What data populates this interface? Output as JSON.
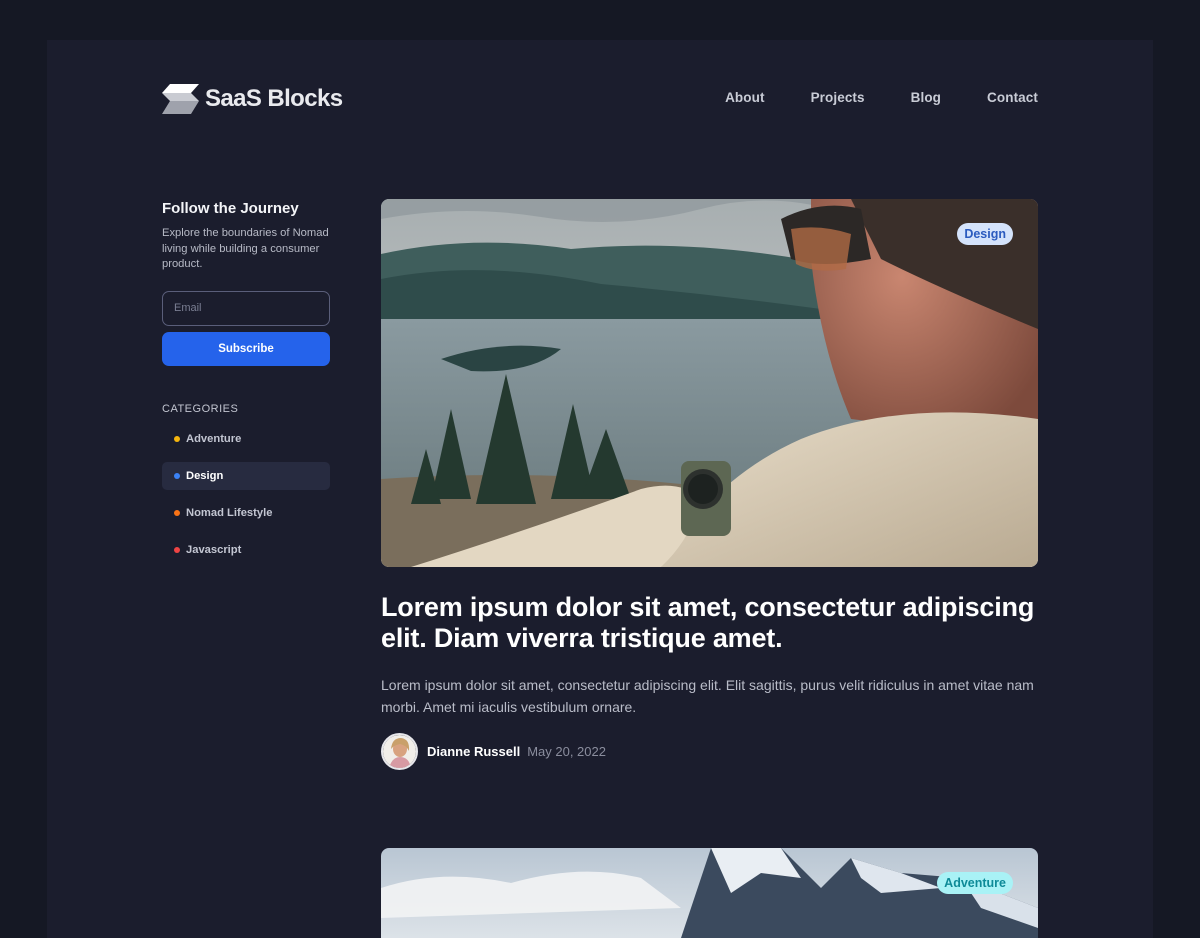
{
  "header": {
    "logo_text": "SaaS Blocks",
    "nav": [
      "About",
      "Projects",
      "Blog",
      "Contact"
    ]
  },
  "sidebar": {
    "title": "Follow the Journey",
    "description": "Explore the boundaries of Nomad living while building a consumer product.",
    "email_placeholder": "Email",
    "email_value": "",
    "subscribe_label": "Subscribe",
    "categories_heading": "CATEGORIES",
    "categories": [
      {
        "label": "Adventure",
        "dot_color": "#f5b50e",
        "active": false
      },
      {
        "label": "Design",
        "dot_color": "#3b82f6",
        "active": true
      },
      {
        "label": "Nomad Lifestyle",
        "dot_color": "#f97316",
        "active": false
      },
      {
        "label": "Javascript",
        "dot_color": "#ef4444",
        "active": false
      }
    ]
  },
  "posts": [
    {
      "badge": "Design",
      "title": "Lorem ipsum dolor sit amet, consectetur adipiscing elit. Diam viverra tristique amet.",
      "excerpt": "Lorem ipsum dolor sit amet, consectetur adipiscing elit. Elit sagittis, purus velit ridiculus in amet vitae nam morbi. Amet mi iaculis vestibulum ornare.",
      "author": "Dianne Russell",
      "date": "May 20, 2022"
    },
    {
      "badge": "Adventure"
    }
  ],
  "colors": {
    "page_bg": "#151824",
    "frame_bg": "#1b1d2d",
    "accent": "#2563eb"
  }
}
